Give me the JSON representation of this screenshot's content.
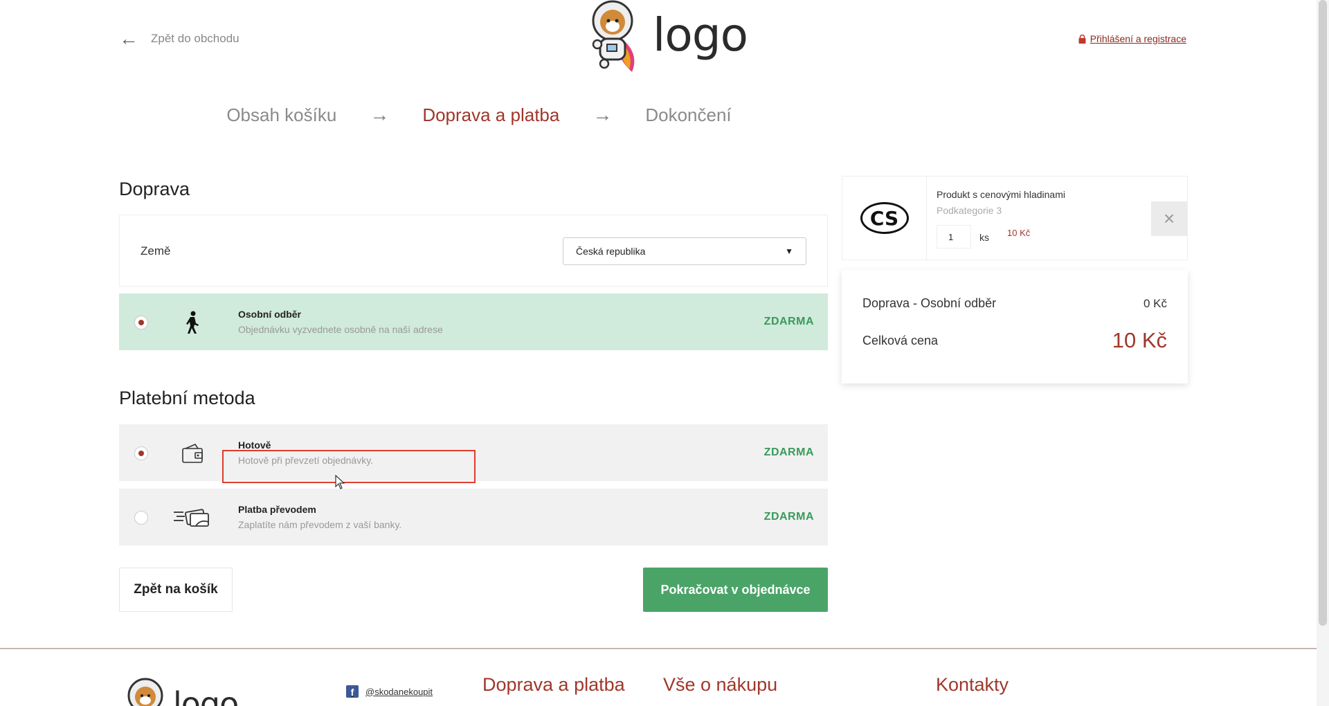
{
  "header": {
    "back_label": "Zpět do obchodu",
    "logo_text": "logo",
    "login_label": "Přihlášení a registrace"
  },
  "steps": [
    {
      "label": "Obsah košíku",
      "active": false
    },
    {
      "label": "Doprava a platba",
      "active": true
    },
    {
      "label": "Dokončení",
      "active": false
    }
  ],
  "shipping": {
    "title": "Doprava",
    "country_label": "Země",
    "country_value": "Česká republika",
    "options": [
      {
        "title": "Osobní odběr",
        "desc": "Objednávku vyzvednete osobně na naší adrese",
        "price": "ZDARMA",
        "selected": true,
        "icon": "walking-person-icon"
      }
    ]
  },
  "payment": {
    "title": "Platební metoda",
    "options": [
      {
        "title": "Hotově",
        "desc": "Hotově při převzetí objednávky.",
        "price": "ZDARMA",
        "selected": true,
        "icon": "wallet-icon"
      },
      {
        "title": "Platba převodem",
        "desc": "Zaplatíte nám převodem z vaší banky.",
        "price": "ZDARMA",
        "selected": false,
        "icon": "money-transfer-icon"
      }
    ]
  },
  "buttons": {
    "back": "Zpět na košík",
    "continue": "Pokračovat v objednávce"
  },
  "cart": {
    "product_name": "Produkt s cenovými hladinami",
    "category": "Podkategorie 3",
    "badge_text": "CS",
    "quantity": "1",
    "unit": "ks",
    "price": "10 Kč",
    "remove_icon": "close-icon"
  },
  "summary": {
    "shipping_label": "Doprava - Osobní odběr",
    "shipping_value": "0 Kč",
    "total_label": "Celková cena",
    "total_value": "10 Kč"
  },
  "footer": {
    "logo_text": "logo",
    "facebook_handle": "@skodanekoupit",
    "headings": [
      "Doprava a platba",
      "Vše o nákupu",
      "Kontakty"
    ]
  },
  "colors": {
    "accent": "#a0372b",
    "green": "#4aa468",
    "selected_bg": "#d0eadb"
  }
}
